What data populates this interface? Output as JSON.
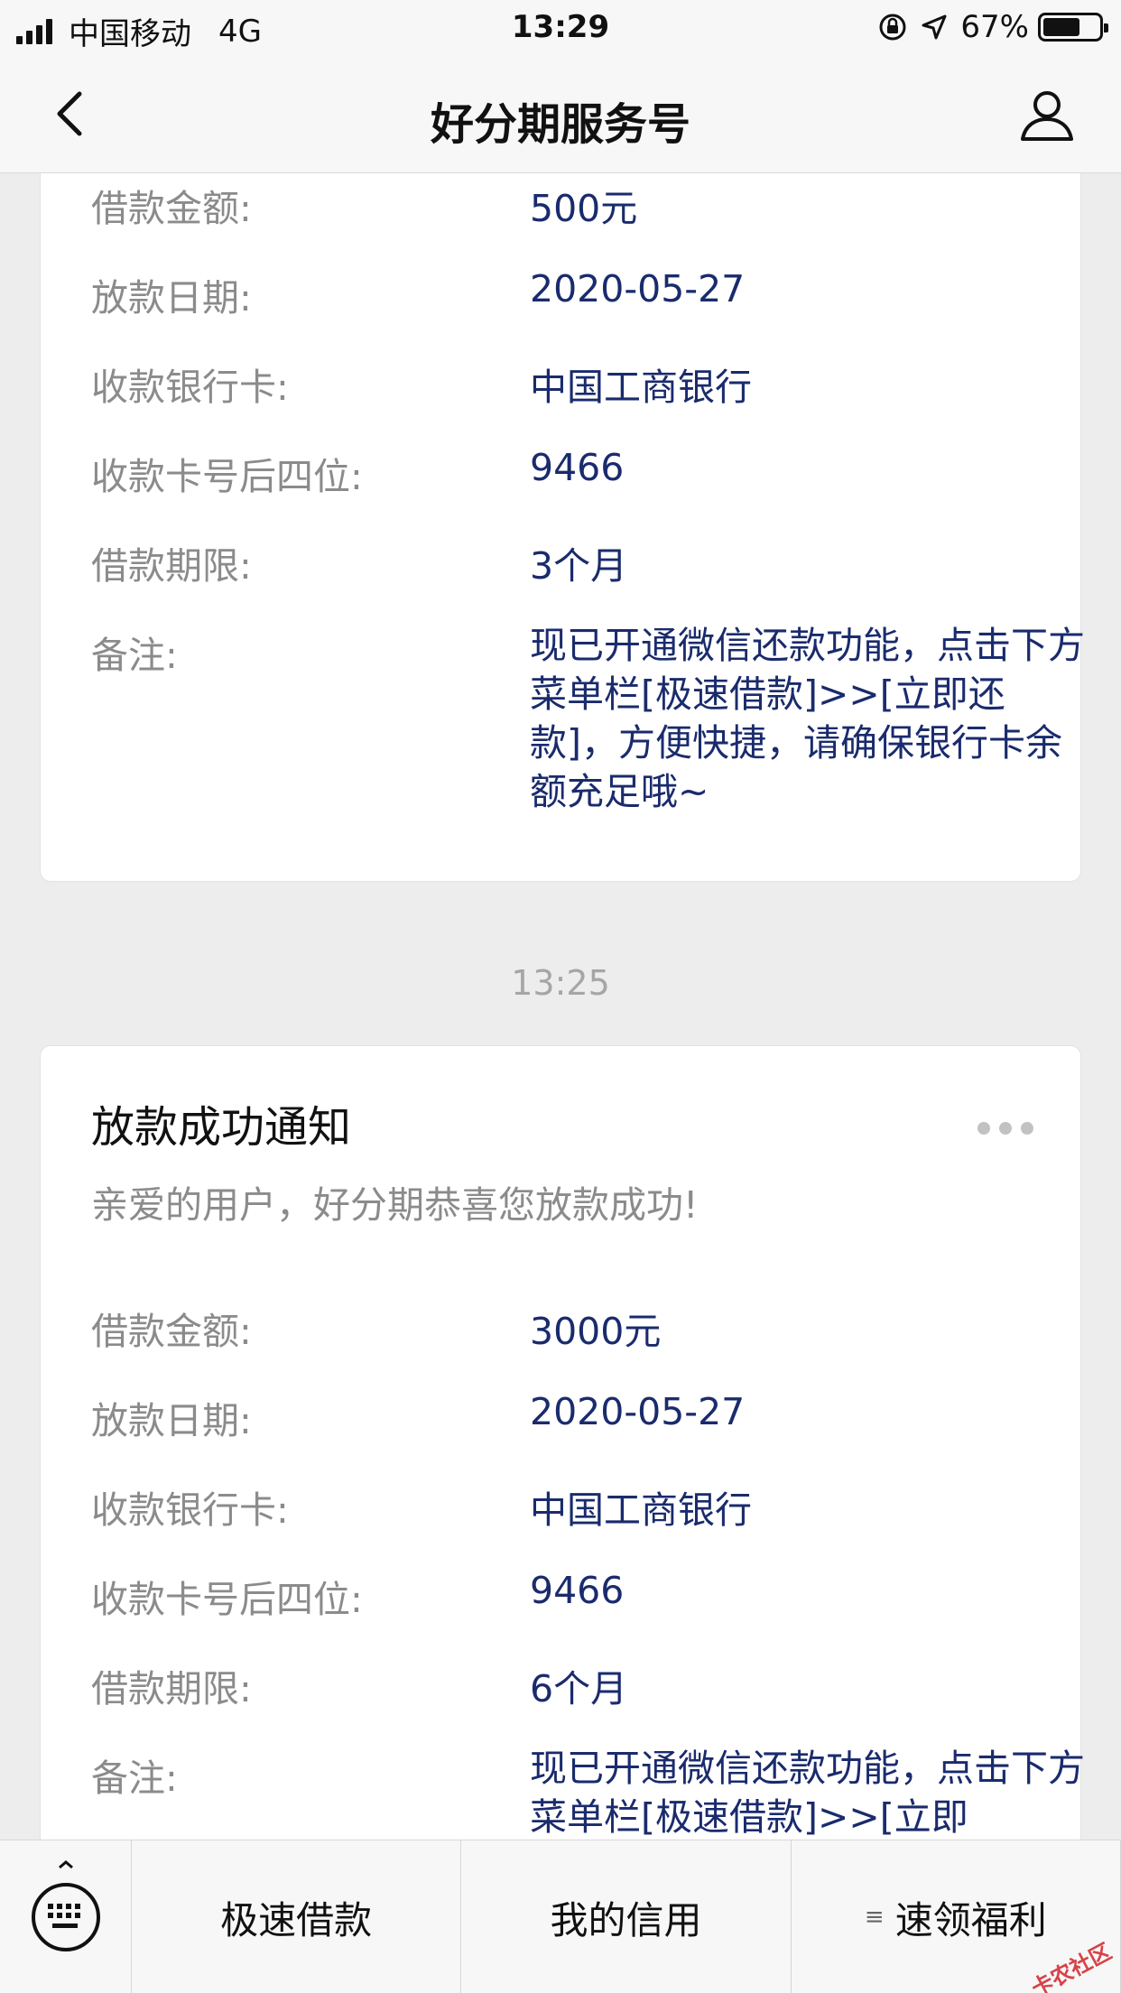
{
  "status_bar": {
    "carrier": "中国移动",
    "network": "4G",
    "time": "13:29",
    "battery_text": "67%",
    "battery_level": 0.67
  },
  "nav": {
    "title": "好分期服务号",
    "back_icon": "chevron-left-icon",
    "user_icon": "person-icon"
  },
  "messages": [
    {
      "rows": [
        {
          "label": "借款金额:",
          "value": "500元"
        },
        {
          "label": "放款日期:",
          "value": "2020-05-27"
        },
        {
          "label": "收款银行卡:",
          "value": "中国工商银行"
        },
        {
          "label": "收款卡号后四位:",
          "value": "9466"
        },
        {
          "label": "借款期限:",
          "value": "3个月"
        },
        {
          "label": "备注:",
          "value": "现已开通微信还款功能，点击下方菜单栏[极速借款]>>[立即还款]，方便快捷，请确保银行卡余额充足哦~"
        }
      ]
    },
    {
      "timestamp": "13:25",
      "title": "放款成功通知",
      "greeting": "亲爱的用户，好分期恭喜您放款成功!",
      "rows": [
        {
          "label": "借款金额:",
          "value": "3000元"
        },
        {
          "label": "放款日期:",
          "value": "2020-05-27"
        },
        {
          "label": "收款银行卡:",
          "value": "中国工商银行"
        },
        {
          "label": "收款卡号后四位:",
          "value": "9466"
        },
        {
          "label": "借款期限:",
          "value": "6个月"
        },
        {
          "label": "备注:",
          "value": "现已开通微信还款功能，点击下方菜单栏[极速借款]>>[立即"
        }
      ]
    }
  ],
  "menu": {
    "keyboard_icon": "keyboard-icon",
    "items": [
      {
        "label": "极速借款"
      },
      {
        "label": "我的信用"
      },
      {
        "label": "速领福利",
        "prefix": "≡"
      }
    ]
  },
  "watermark": "卡农社区"
}
